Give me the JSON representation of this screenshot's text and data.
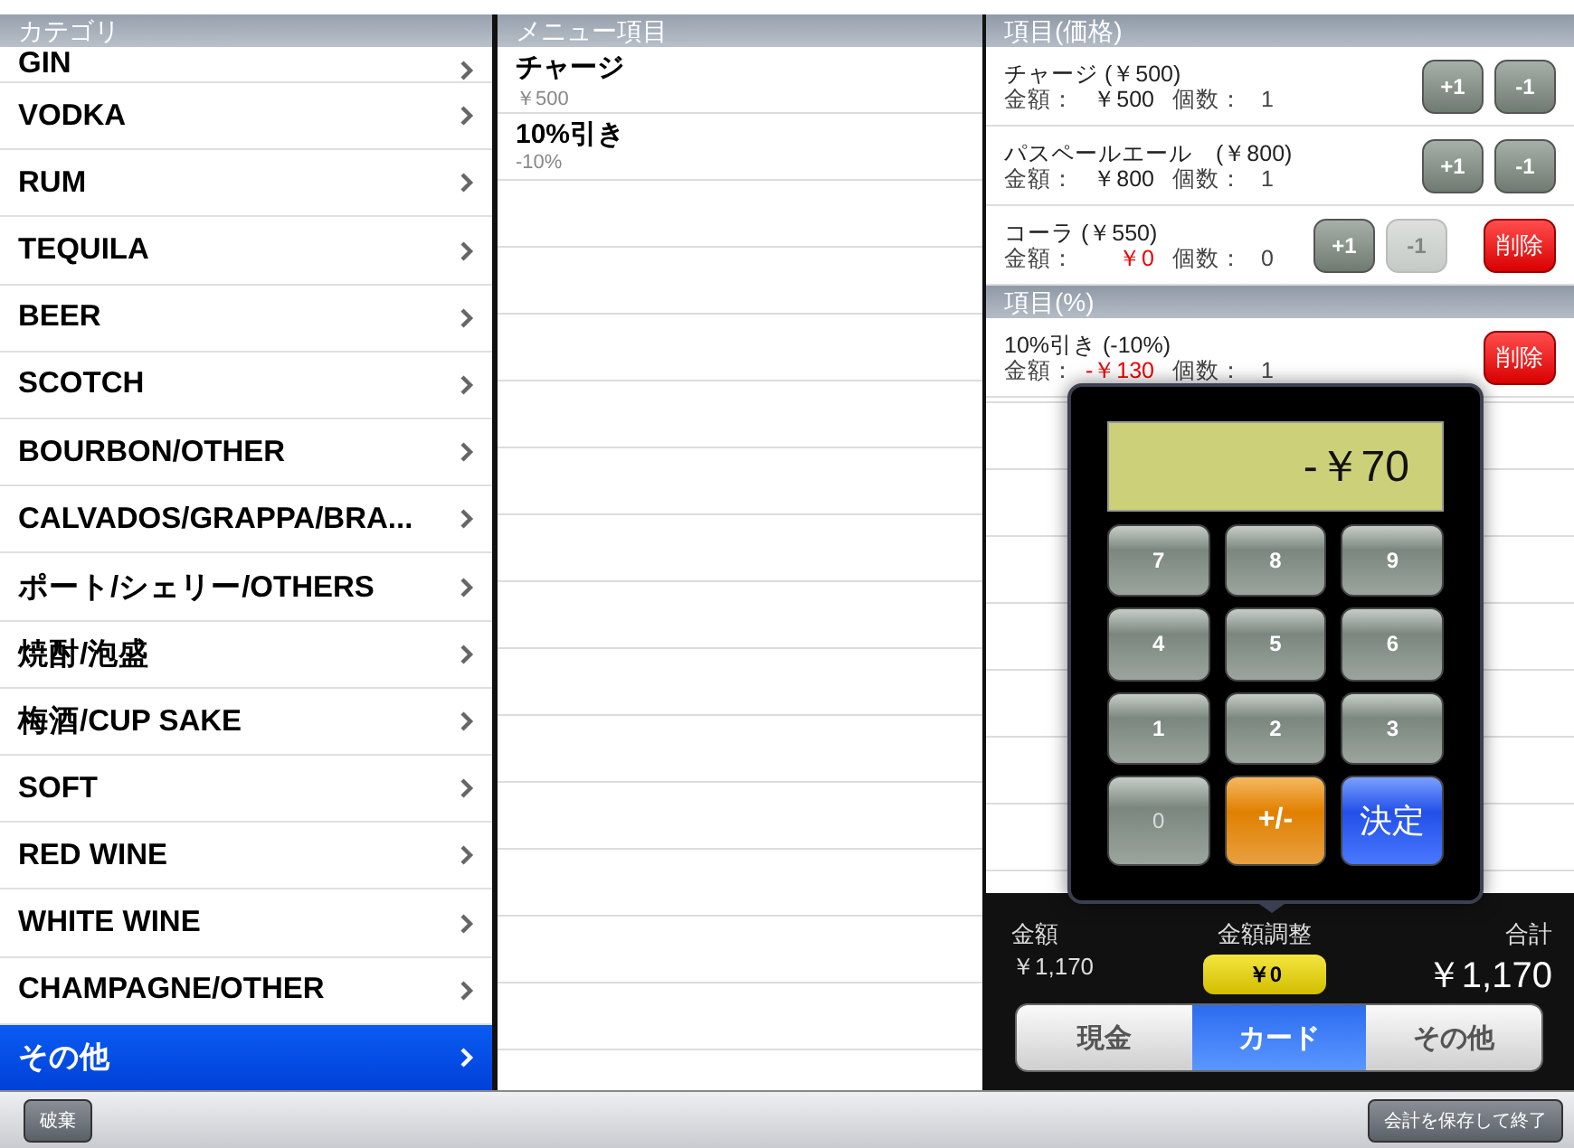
{
  "categories": {
    "header": "カテゴリ",
    "items": [
      {
        "label": "GIN",
        "selected": false
      },
      {
        "label": "VODKA",
        "selected": false
      },
      {
        "label": "RUM",
        "selected": false
      },
      {
        "label": "TEQUILA",
        "selected": false
      },
      {
        "label": "BEER",
        "selected": false
      },
      {
        "label": "SCOTCH",
        "selected": false
      },
      {
        "label": "BOURBON/OTHER",
        "selected": false
      },
      {
        "label": "CALVADOS/GRAPPA/BRA...",
        "selected": false
      },
      {
        "label": "ポート/シェリー/OTHERS",
        "selected": false
      },
      {
        "label": "焼酎/泡盛",
        "selected": false
      },
      {
        "label": "梅酒/CUP SAKE",
        "selected": false
      },
      {
        "label": "SOFT",
        "selected": false
      },
      {
        "label": "RED WINE",
        "selected": false
      },
      {
        "label": "WHITE WINE",
        "selected": false
      },
      {
        "label": "CHAMPAGNE/OTHER",
        "selected": false
      },
      {
        "label": "その他",
        "selected": true
      }
    ]
  },
  "menu": {
    "header": "メニュー項目",
    "items": [
      {
        "name": "チャージ",
        "price": "￥500"
      },
      {
        "name": "10%引き",
        "price": "-10%"
      }
    ]
  },
  "price_items": {
    "header": "項目(価格)",
    "items": [
      {
        "name": "チャージ (￥500)",
        "amount_label": "金額：",
        "amount": "￥500",
        "highlight": false,
        "count_label": "個数：",
        "count": "1",
        "buttons": [
          {
            "label": "+1",
            "disabled": false
          },
          {
            "label": "-1",
            "disabled": false
          }
        ]
      },
      {
        "name": "パスペールエール　(￥800)",
        "amount_label": "金額：",
        "amount": "￥800",
        "highlight": false,
        "count_label": "個数：",
        "count": "1",
        "buttons": [
          {
            "label": "+1",
            "disabled": false
          },
          {
            "label": "-1",
            "disabled": false
          }
        ]
      },
      {
        "name": "コーラ (￥550)",
        "amount_label": "金額：",
        "amount": "￥0",
        "highlight": true,
        "count_label": "個数：",
        "count": "0",
        "buttons": [
          {
            "label": "+1",
            "disabled": false
          },
          {
            "label": "-1",
            "disabled": true
          }
        ],
        "delete": "削除"
      }
    ]
  },
  "percent_items": {
    "header": "項目(%)",
    "items": [
      {
        "name": "10%引き (-10%)",
        "amount_label": "金額：",
        "amount": "-￥130",
        "highlight": true,
        "count_label": "個数：",
        "count": "1",
        "delete": "削除"
      }
    ]
  },
  "totals": {
    "amount_label": "金額",
    "amount": "￥1,170",
    "adjust_label": "金額調整",
    "adjust": "￥0",
    "total_label": "合計",
    "total": "￥1,170"
  },
  "payment": [
    {
      "label": "現金",
      "selected": false
    },
    {
      "label": "カード",
      "selected": true
    },
    {
      "label": "その他",
      "selected": false
    }
  ],
  "calculator": {
    "display": "-￥70",
    "keys": [
      {
        "label": "7",
        "kind": "digit"
      },
      {
        "label": "8",
        "kind": "digit"
      },
      {
        "label": "9",
        "kind": "digit"
      },
      {
        "label": "4",
        "kind": "digit"
      },
      {
        "label": "5",
        "kind": "digit"
      },
      {
        "label": "6",
        "kind": "digit"
      },
      {
        "label": "1",
        "kind": "digit"
      },
      {
        "label": "2",
        "kind": "digit"
      },
      {
        "label": "3",
        "kind": "digit"
      },
      {
        "label": "0",
        "kind": "zero"
      },
      {
        "label": "+/-",
        "kind": "sign"
      },
      {
        "label": "決定",
        "kind": "enter"
      }
    ]
  },
  "toolbar": {
    "left_button": "破棄",
    "right_button": "会計を保存して終了"
  }
}
